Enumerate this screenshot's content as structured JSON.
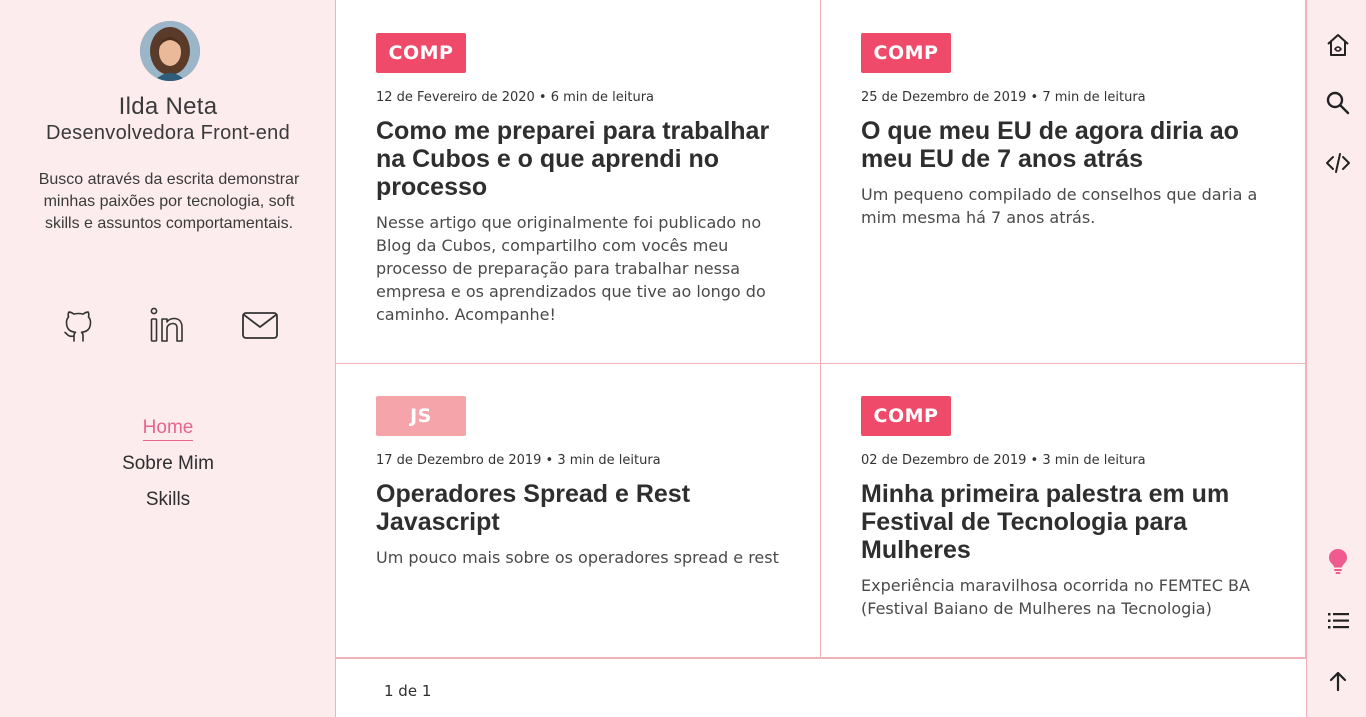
{
  "profile": {
    "name": "Ilda Neta",
    "role": "Desenvolvedora Front-end",
    "bio": "Busco através da escrita demonstrar minhas paixões por tecnologia, soft skills e assuntos comportamentais."
  },
  "social": [
    {
      "icon": "github-icon"
    },
    {
      "icon": "linkedin-icon"
    },
    {
      "icon": "mail-icon"
    }
  ],
  "nav": [
    {
      "label": "Home",
      "active": true
    },
    {
      "label": "Sobre Mim",
      "active": false
    },
    {
      "label": "Skills",
      "active": false
    }
  ],
  "posts": [
    {
      "tag": "COMP",
      "tag_color": "#ef4a6a",
      "meta": "12 de Fevereiro de 2020 • 6 min de leitura",
      "title": "Como me preparei para trabalhar na Cubos e o que aprendi no processo",
      "description": "Nesse artigo que originalmente foi publicado no Blog da Cubos, compartilho com vocês meu processo de preparação para trabalhar nessa empresa e os aprendizados que tive ao longo do caminho. Acompanhe!"
    },
    {
      "tag": "COMP",
      "tag_color": "#ef4a6a",
      "meta": "25 de Dezembro de 2019 • 7 min de leitura",
      "title": "O que meu EU de agora diria ao meu EU de 7 anos atrás",
      "description": "Um pequeno compilado de conselhos que daria a mim mesma há 7 anos atrás."
    },
    {
      "tag": "JS",
      "tag_color": "#f5a5aa",
      "meta": "17 de Dezembro de 2019 • 3 min de leitura",
      "title": "Operadores Spread e Rest Javascript",
      "description": "Um pouco mais sobre os operadores spread e rest"
    },
    {
      "tag": "COMP",
      "tag_color": "#ef4a6a",
      "meta": "02 de Dezembro de 2019 • 3 min de leitura",
      "title": "Minha primeira palestra em um Festival de Tecnologia para Mulheres",
      "description": "Experiência maravilhosa ocorrida no FEMTEC BA (Festival Baiano de Mulheres na Tecnologia)"
    }
  ],
  "pagination": {
    "label": "1 de 1"
  },
  "rail": [
    {
      "icon": "home-icon"
    },
    {
      "icon": "search-icon"
    },
    {
      "icon": "code-icon"
    },
    {
      "icon": "lightbulb-icon",
      "color": "#ef5b8f"
    },
    {
      "icon": "list-icon"
    },
    {
      "icon": "arrow-up-icon"
    }
  ],
  "colors": {
    "sidebar_bg": "#fdeced",
    "border": "#f0b2b8",
    "accent": "#e8658b"
  }
}
